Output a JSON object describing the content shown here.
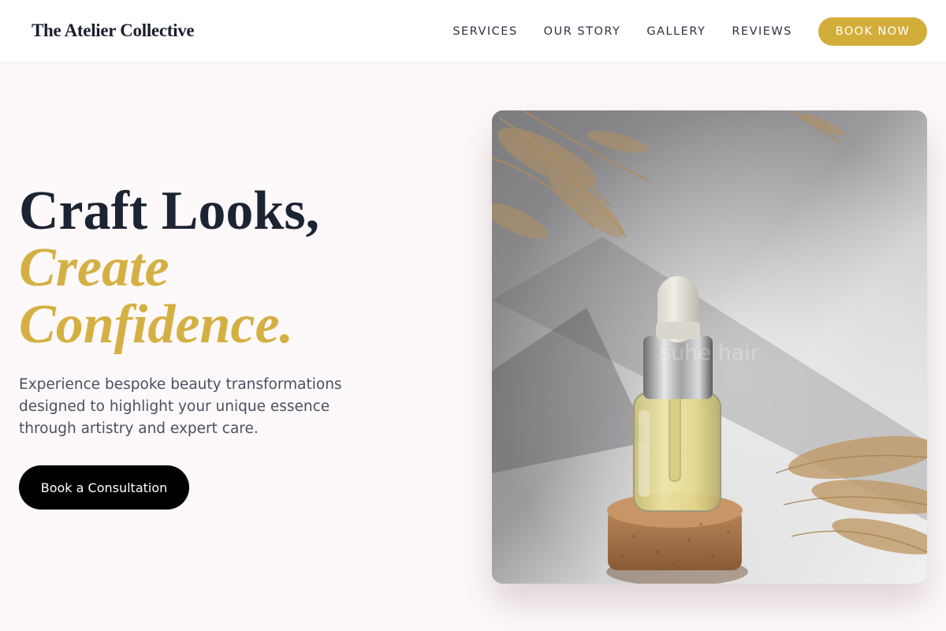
{
  "header": {
    "brand": "The Atelier Collective",
    "nav": [
      "SERVICES",
      "OUR STORY",
      "GALLERY",
      "REVIEWS"
    ],
    "book_label": "BOOK NOW"
  },
  "hero": {
    "title_line1": "Craft Looks,",
    "title_line2": "Create",
    "title_line3": "Confidence.",
    "subtitle": "Experience bespoke beauty transformations designed to highlight your unique essence through artistry and expert care.",
    "cta_label": "Book a Consultation",
    "image_watermark": "suhe hair"
  },
  "colors": {
    "accent": "#d3ad3a",
    "dark": "#1c2433",
    "background": "#fdf8f9"
  }
}
